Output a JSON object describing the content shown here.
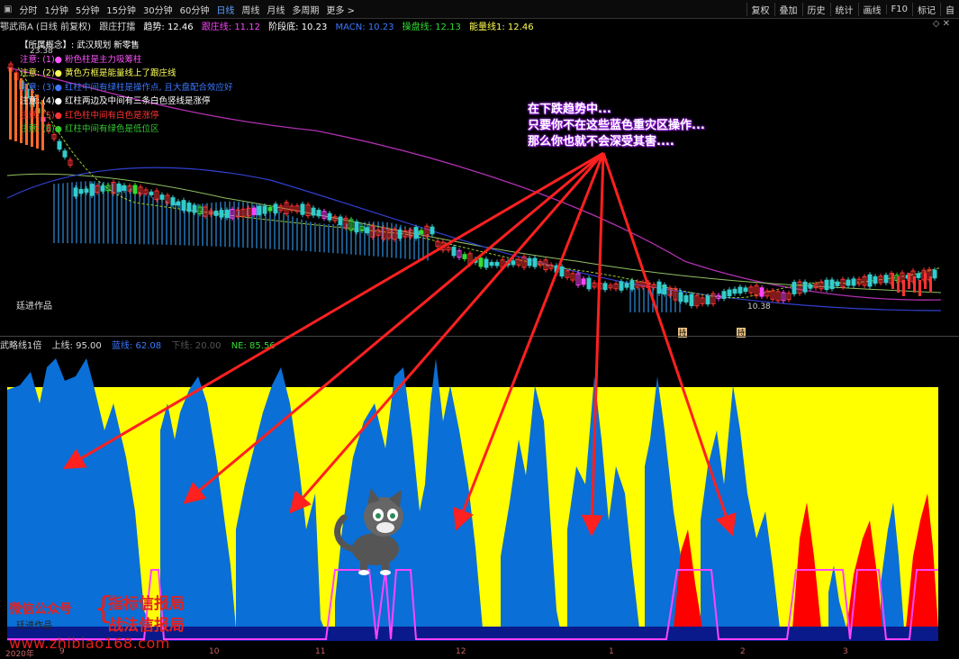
{
  "toolbar": {
    "left_items": [
      "分时",
      "1分钟",
      "5分钟",
      "15分钟",
      "30分钟",
      "60分钟",
      "日线",
      "周线",
      "月线",
      "多周期",
      "更多 >"
    ],
    "right_items": [
      "复权",
      "叠加",
      "历史",
      "统计",
      "画线",
      "F10",
      "标记",
      "自"
    ]
  },
  "infobar": {
    "title": "鄂武商A (日线 前复权)",
    "indicator": "跟庄打擂",
    "trend": "趋势: 12.46",
    "follow": "跟庄线: 11.12",
    "stage_bottom": "阶段底: 10.23",
    "macn": "MACN: 10.23",
    "operate": "操盘线: 12.13",
    "energy": "能量线1: 12.46"
  },
  "legend": [
    {
      "text": "【所属概念】: 武汉规划 新零售",
      "color": "#ffffff"
    },
    {
      "text": "注意: (1)●   粉色柱是主力吸筹柱",
      "color": "#ff55ff"
    },
    {
      "text": "注意: (2)●   黄色方框是能量线上了跟庄线",
      "color": "#ffff55"
    },
    {
      "text": "注意: (3)●   红柱中间有绿柱是操作点, 且大盘配合效应好",
      "color": "#3c78ff"
    },
    {
      "text": "注意: (4)●   红柱两边及中间有三条白色竖线是涨停",
      "color": "#ffffff"
    },
    {
      "text": "注意: (5)●   红色柱中间有白色是涨停",
      "color": "#ff3333"
    },
    {
      "text": "注意: (6)●   红柱中间有绿色是低位区",
      "color": "#33cc33"
    }
  ],
  "annotation": [
    "在下跌趋势中...",
    "只要你不在这些蓝色重灾区操作...",
    "那么你也就不会深受其害...."
  ],
  "price_high": "23.38",
  "price_low": "10.38",
  "watermark": "廷进作品",
  "indicator2": {
    "name": "武略线1倍",
    "upper": "上线: 95.00",
    "mid": "蓝线: 62.08",
    "low": "下线: 20.00",
    "extra": "NE: 85.56"
  },
  "promo": {
    "wechat": "微信公众号",
    "brand1": "指标信报局",
    "brand2": "战法信报局",
    "url": "www.zhibiao168.com"
  },
  "date_axis": [
    "2020年",
    "9",
    "10",
    "11",
    "12",
    "1",
    "2",
    "3"
  ],
  "markers": [
    "持",
    "持"
  ],
  "colors": {
    "background": "#000000",
    "yellow": "#ffff00",
    "blue": "#0a6fd6",
    "navy": "#0a1a8a",
    "red": "#ff0000",
    "magenta": "#ff44ff",
    "arrow": "#ff2020"
  }
}
